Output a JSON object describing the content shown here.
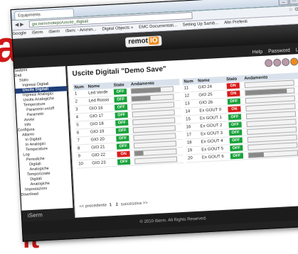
{
  "browser": {
    "tab_title": "Equipments",
    "url": "gw.iservmotepo/uscite_digitali",
    "bookmarks": [
      "Google",
      "iSerm",
      "iSerm",
      "iServ. - Ammin...",
      "Digital Objects »",
      "EMC Documentati...",
      "Setting Up Samb...",
      "Altri Preferiti"
    ]
  },
  "app": {
    "logo_text": "remot",
    "logo_io": "IO",
    "top_menu": [
      "Help",
      "Password",
      "Logout"
    ],
    "page_title": "Uscite Digitali \"Demo Save\"",
    "sidebar": [
      {
        "label": "Sistemi",
        "active": false
      },
      {
        "label": "Dati",
        "active": false
      },
      {
        "label": "Stato",
        "active": false
      },
      {
        "label": "Ingressi Digitali",
        "active": false
      },
      {
        "label": "Uscite Digitali",
        "active": true
      },
      {
        "label": "Ingressi Analogici",
        "active": false
      },
      {
        "label": "Uscite Analogiche",
        "active": false
      },
      {
        "label": "Temperature",
        "active": false
      },
      {
        "label": "Parametri on/off",
        "active": false
      },
      {
        "label": "Parametri",
        "active": false
      },
      {
        "label": "Avvisi",
        "active": false
      },
      {
        "label": "Info",
        "active": false
      },
      {
        "label": "Configura",
        "active": false
      },
      {
        "label": "Allarmi",
        "active": false
      },
      {
        "label": "In Digitali",
        "active": false
      },
      {
        "label": "In Analogici",
        "active": false
      },
      {
        "label": "Temperature",
        "active": false
      },
      {
        "label": "Log",
        "active": false
      },
      {
        "label": "Periodiche",
        "active": false
      },
      {
        "label": "Digitali",
        "active": false
      },
      {
        "label": "Analogiche",
        "active": false
      },
      {
        "label": "Temporizzate",
        "active": false
      },
      {
        "label": "Digitali",
        "active": false
      },
      {
        "label": "Analogiche",
        "active": false
      },
      {
        "label": "Impostazioni",
        "active": false
      },
      {
        "label": "Download",
        "active": false
      }
    ],
    "sidebar_brand": "iSerm",
    "columns": {
      "num": "Num",
      "name": "Nome",
      "state": "Stato",
      "trend": "Andamento"
    },
    "left_rows": [
      {
        "num": "1",
        "name": "Led Verde",
        "state": "OFF",
        "trend": 0.7
      },
      {
        "num": "2",
        "name": "Led Rosso",
        "state": "OFF",
        "trend": 0.45
      },
      {
        "num": "3",
        "name": "GIO 16",
        "state": "OFF",
        "trend": 0
      },
      {
        "num": "4",
        "name": "GIO 17",
        "state": "OFF",
        "trend": 0
      },
      {
        "num": "5",
        "name": "GIO 18",
        "state": "OFF",
        "trend": 0
      },
      {
        "num": "6",
        "name": "GIO 19",
        "state": "OFF",
        "trend": 0
      },
      {
        "num": "7",
        "name": "GIO 20",
        "state": "OFF",
        "trend": 0
      },
      {
        "num": "8",
        "name": "GIO 21",
        "state": "OFF",
        "trend": 0
      },
      {
        "num": "9",
        "name": "GIO 22",
        "state": "ON",
        "trend": 0.2
      },
      {
        "num": "10",
        "name": "GIO 23",
        "state": "OFF",
        "trend": 0
      }
    ],
    "right_rows": [
      {
        "num": "11",
        "name": "GIO 24",
        "state": "ON",
        "trend": 0
      },
      {
        "num": "12",
        "name": "GIO 25",
        "state": "ON",
        "trend": 0.85
      },
      {
        "num": "13",
        "name": "GIO 26",
        "state": "OFF",
        "trend": 0
      },
      {
        "num": "14",
        "name": "Ex GOUT 0",
        "state": "ON",
        "trend": 0
      },
      {
        "num": "15",
        "name": "Ex GOUT 1",
        "state": "OFF",
        "trend": 0
      },
      {
        "num": "16",
        "name": "Ex GOUT 2",
        "state": "OFF",
        "trend": 0
      },
      {
        "num": "17",
        "name": "Ex GOUT 3",
        "state": "OFF",
        "trend": 0
      },
      {
        "num": "18",
        "name": "Ex GOUT 4",
        "state": "OFF",
        "trend": 0
      },
      {
        "num": "19",
        "name": "Ex GOUT 5",
        "state": "OFF",
        "trend": 0
      },
      {
        "num": "20",
        "name": "Ex GOUT 6",
        "state": "OFF",
        "trend": 0.3
      }
    ],
    "pager": {
      "prev": "<< precedente",
      "page1": "1",
      "page2": "2",
      "next": "successiva >>"
    },
    "footer": "© 2010 iSerm. All Rights Reserved."
  },
  "decor": {
    "letter_top": "a",
    "letter_bottom": "it"
  },
  "colors": {
    "off": "#18a23a",
    "on": "#d81c1c",
    "accent": "#f08a1c"
  }
}
